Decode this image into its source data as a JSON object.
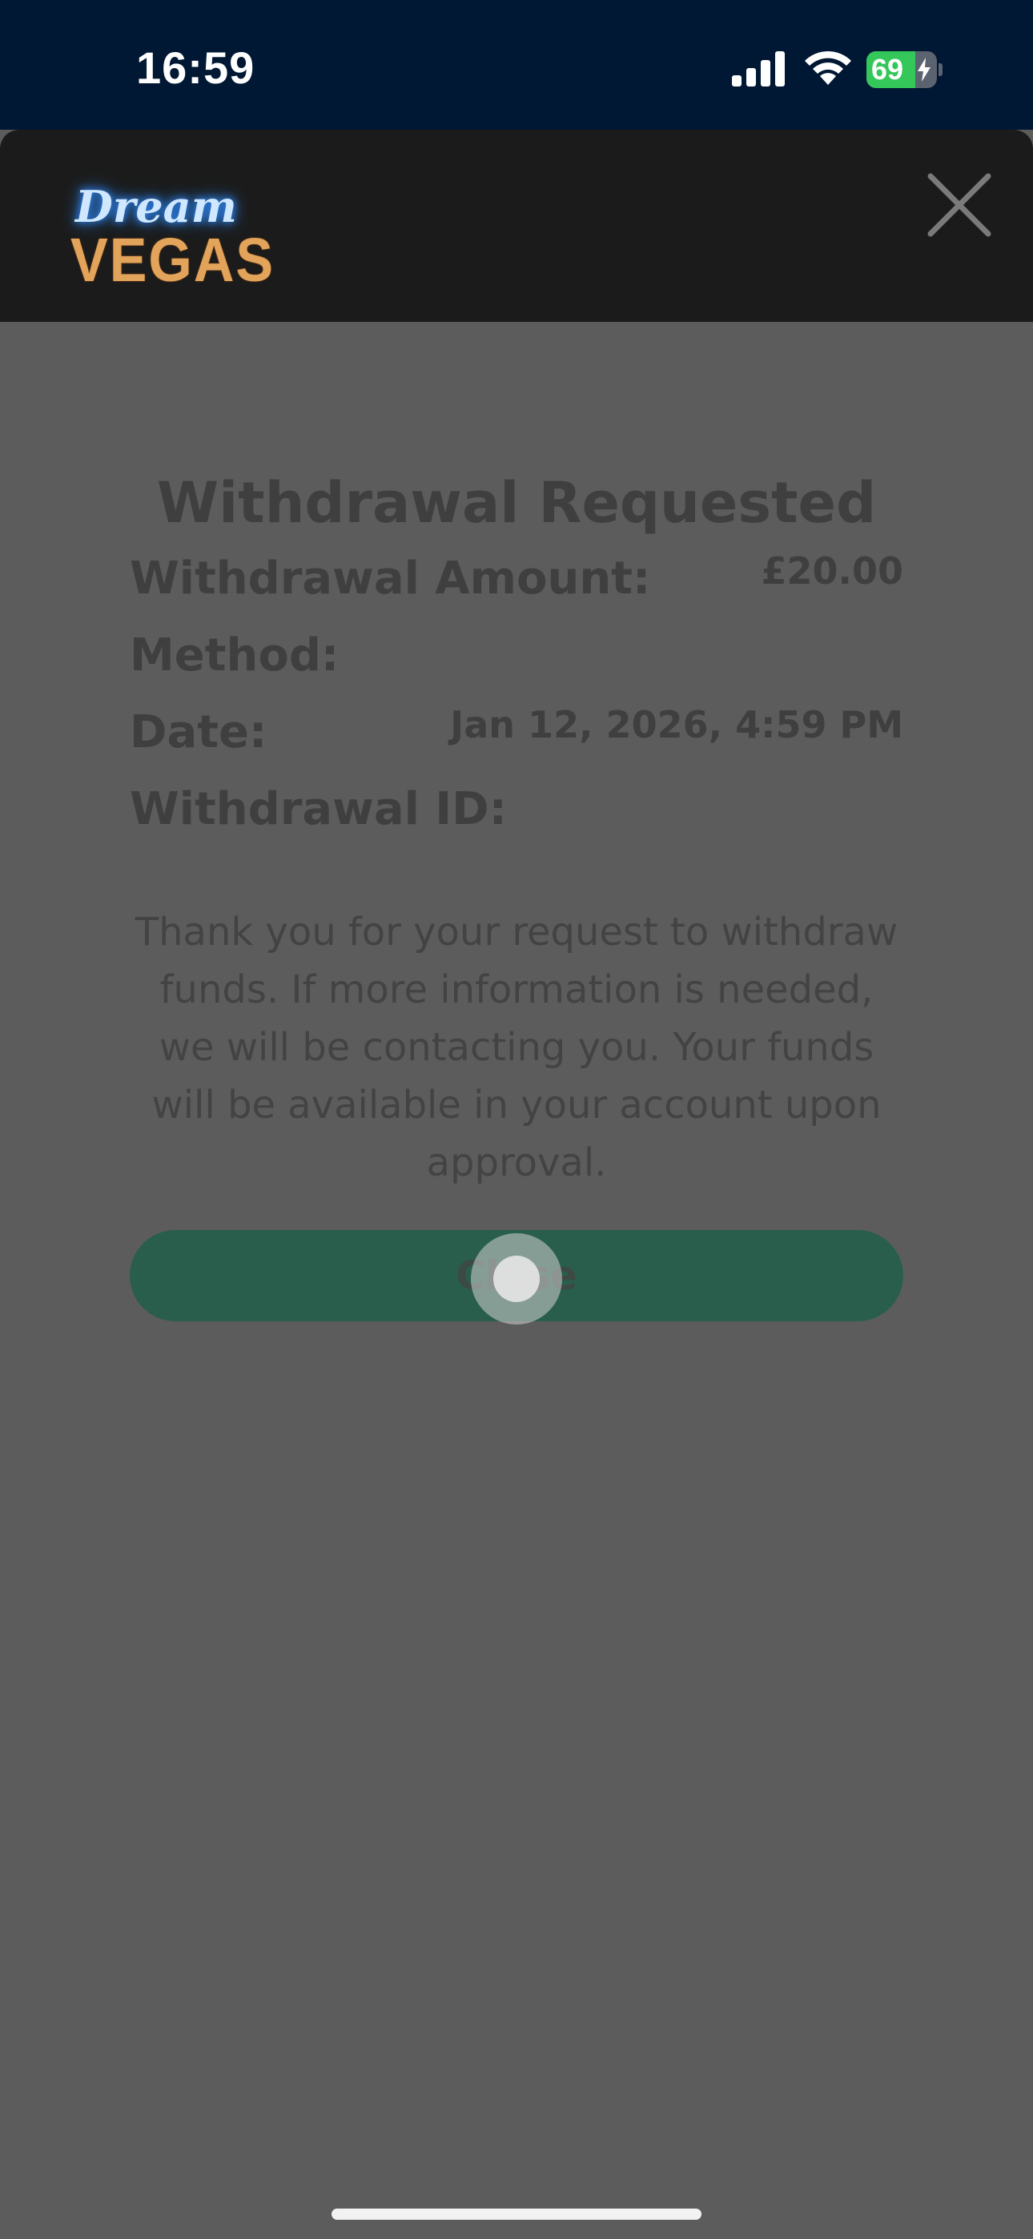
{
  "status_bar": {
    "time": "16:59",
    "battery_percent": "69",
    "icons": [
      "signal-icon",
      "wifi-icon",
      "battery-icon",
      "charging-bolt-icon"
    ]
  },
  "header": {
    "logo_script": "Dream",
    "logo_block": "VEGAS",
    "close_icon": "close-icon"
  },
  "withdrawal": {
    "title": "Withdrawal Requested",
    "rows": [
      {
        "label": "Withdrawal Amount:",
        "value": "£20.00"
      },
      {
        "label": "Method:",
        "value": ""
      },
      {
        "label": "Date:",
        "value": "Jan 12, 2026, 4:59 PM"
      },
      {
        "label": "Withdrawal ID:",
        "value": ""
      }
    ],
    "message": "Thank you for your request to withdraw funds. If more information is needed, we will be contacting you. Your funds will be available in your account upon approval.",
    "close_label": "Close"
  },
  "colors": {
    "status_bar_bg": "#001833",
    "header_bg": "#1b1b1b",
    "overlay_bg": "#5c5c5c",
    "button_bg": "#2a5e4c",
    "battery_fill": "#34c759"
  }
}
